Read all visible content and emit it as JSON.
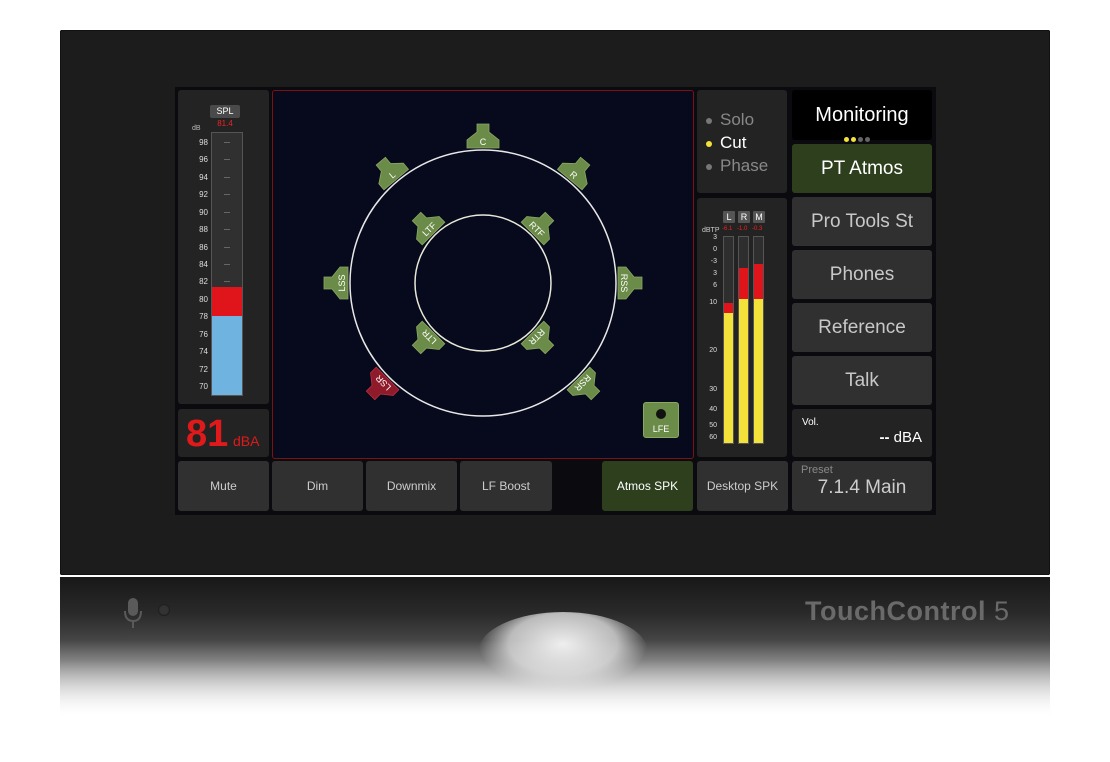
{
  "device": {
    "brand_bold": "TouchControl",
    "brand_num": "5"
  },
  "spl": {
    "label": "SPL",
    "peak": "81.4",
    "unit_label": "dB",
    "scale": [
      "98",
      "96",
      "94",
      "92",
      "90",
      "88",
      "86",
      "84",
      "82",
      "80",
      "78",
      "76",
      "74",
      "72",
      "70"
    ],
    "level_db": 78,
    "peak_db": 81.4,
    "range_db": [
      69,
      99
    ],
    "reading": "81",
    "reading_unit": "dBA"
  },
  "speakers": {
    "outer": [
      "L",
      "C",
      "R",
      "LSS",
      "RSS",
      "LSR",
      "RSR"
    ],
    "inner": [
      "LTF",
      "RTF",
      "LTR",
      "RTR"
    ],
    "muted": [
      "LSR"
    ],
    "lfe_label": "LFE",
    "colors": {
      "speaker": "#6b8b48",
      "muted": "#8e1a2a",
      "ring": "#ffffff",
      "frame": "#7a1414"
    }
  },
  "modes": [
    {
      "label": "Solo",
      "active": false
    },
    {
      "label": "Cut",
      "active": true
    },
    {
      "label": "Phase",
      "active": false
    }
  ],
  "loudness": {
    "channels": [
      "L",
      "R",
      "M"
    ],
    "peaks": [
      "-6.1",
      "-1.0",
      "-0.3"
    ],
    "unit_label": "dBTP",
    "scale": [
      "3",
      "0",
      "-3",
      "3",
      "6",
      "10",
      "20",
      "30",
      "40",
      "50",
      "60"
    ],
    "levels": [
      {
        "yellow": 0.63,
        "red": 0.68
      },
      {
        "yellow": 0.7,
        "red": 0.85
      },
      {
        "yellow": 0.7,
        "red": 0.87
      }
    ]
  },
  "monitoring": {
    "title": "Monitoring",
    "page_dots": [
      true,
      true,
      false,
      false
    ],
    "sources": [
      {
        "label": "PT Atmos",
        "active": true
      },
      {
        "label": "Pro Tools St",
        "active": false
      },
      {
        "label": "Phones",
        "active": false
      },
      {
        "label": "Reference",
        "active": false
      },
      {
        "label": "Talk",
        "active": false
      }
    ],
    "vol_label": "Vol.",
    "vol_value": "--",
    "vol_unit": "dBA"
  },
  "bottom_buttons": [
    {
      "label": "Mute",
      "active": false
    },
    {
      "label": "Dim",
      "active": false
    },
    {
      "label": "Downmix",
      "active": false
    },
    {
      "label": "LF Boost",
      "active": false
    },
    {
      "label": "Atmos SPK",
      "active": true
    },
    {
      "label": "Desktop SPK",
      "active": false
    }
  ],
  "preset": {
    "label": "Preset",
    "value": "7.1.4 Main"
  },
  "colors": {
    "accent_yellow": "#f3e23a",
    "alert_red": "#e0141b",
    "active_green": "#2d3f1d"
  }
}
